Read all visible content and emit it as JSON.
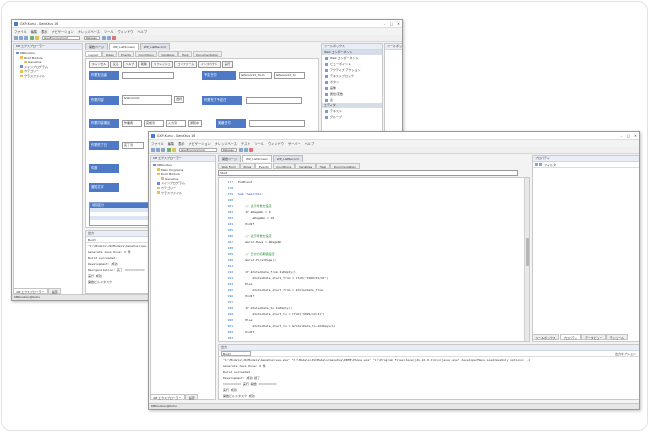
{
  "back_window": {
    "title": "GXP-Kuhu - GeneXus 16",
    "menu": [
      "ファイル",
      "編集",
      "表示",
      "ナビゲーション",
      "ナレッジベース",
      "ツール",
      "ウィンドウ",
      "ヘルプ"
    ],
    "env_combo": "JavaEnvironment",
    "config_combo": "Release",
    "kb_explorer_title": "KB エクスプローラー",
    "tree": [
      "KBKoubou",
      "Root Module",
      "GeneXus",
      "メインプログラム",
      "カテゴリー",
      "クラスファイル"
    ],
    "tabs": [
      "開始ページ",
      "WP_ListScreen",
      "WP_ListRecord"
    ],
    "subtabs": [
      "Layout",
      "Rules",
      "Events",
      "Conditions",
      "Variables",
      "Help",
      "Documentation"
    ],
    "form_buttons": [
      "キャンセル",
      "戻る",
      "ヘルプ",
      "削除",
      "リフレッシュ",
      "コンファーム",
      "インスペクト",
      "実行"
    ],
    "form_labels": [
      "作業担当者",
      "作業内容",
      "予定日付",
      "作業内容補足",
      "作業完了予定日",
      "実績日付",
      "作業終了日",
      "件数",
      "通知文字"
    ],
    "form_values": [
      "&PersonId_from",
      "&PersonId_to",
      "&WorkInfo",
      "選択",
      "作業者",
      "完成済",
      "入力済",
      "通知中",
      "完了済"
    ],
    "grid_header": "項目区分",
    "output_title": "出力",
    "output_filter": "Build",
    "output_lines": [
      "\"C:\\Models\\JSCModels\\GeneXus\\vea.exe\" ...",
      "Generate Java Done: 0 件",
      "Build succeeded.",
      "Development: 成功",
      "Reorganization: 完了 ===========",
      "実行 成功",
      "開始ビルドタスク"
    ],
    "toolbox_title": "ツールボックス",
    "toolbox_sections": [
      "Web コンポーネント",
      "エディタ"
    ],
    "toolbox_items": [
      "Web コンポーネント",
      "ビューポイント",
      "アクティブ アクション",
      "テキストブロック",
      "ボタン",
      "画像",
      "属性/変数",
      "表"
    ],
    "toolbox_items2": [
      "テキスト",
      "グループ"
    ],
    "bottom_tabs": [
      "KB エクスプローラー",
      "設定"
    ],
    "status": "KBKoubou@Kuhu"
  },
  "front_window": {
    "title": "GXP-Kuhu - GeneXus 16",
    "menu": [
      "ファイル",
      "編集",
      "表示",
      "ナビゲーション",
      "ナレッジベース",
      "テスト",
      "ツール",
      "ウィンドウ",
      "サーバー",
      "ヘルプ"
    ],
    "env_combo": "JavaEnvironment",
    "config_combo": "Release",
    "kb_explorer_title": "KB エクスプローラー",
    "tree": [
      "KBKoubou",
      "Main Programs",
      "Root Module",
      "GeneXus",
      "メインプログラム",
      "カテゴリー",
      "クラスファイル"
    ],
    "tabs": [
      "開始ページ",
      "WP_ListScreen",
      "WP_ListRecord"
    ],
    "subtabs": [
      "Web Form",
      "Rules",
      "Events",
      "Conditions",
      "Variables",
      "Help",
      "Documentation"
    ],
    "event_combo": "Start",
    "code_lines": [
      {
        "n": "177",
        "t": "EndEvent",
        "c": ""
      },
      {
        "n": "178",
        "t": "",
        "c": ""
      },
      {
        "n": "179",
        "t": "Sub 'SearchCo'",
        "c": "kw"
      },
      {
        "n": "180",
        "t": "",
        "c": ""
      },
      {
        "n": "181",
        "t": "    // 表示件数を設定",
        "c": "cm"
      },
      {
        "n": "182",
        "t": "    If &PageNo = 0",
        "c": ""
      },
      {
        "n": "183",
        "t": "        &PageNo = 10",
        "c": ""
      },
      {
        "n": "184",
        "t": "    EndIf",
        "c": ""
      },
      {
        "n": "185",
        "t": "",
        "c": ""
      },
      {
        "n": "186",
        "t": "    // 表示件数を設定",
        "c": "cm"
      },
      {
        "n": "187",
        "t": "    &Grid.Rows = &PageNo",
        "c": ""
      },
      {
        "n": "188",
        "t": "",
        "c": ""
      },
      {
        "n": "189",
        "t": "    // 日付の初期値設定",
        "c": "cm"
      },
      {
        "n": "190",
        "t": "    &Grid.FirstPage()",
        "c": ""
      },
      {
        "n": "191",
        "t": "",
        "c": ""
      },
      {
        "n": "192",
        "t": "    If &YoteiDate_from.IsEmpty()",
        "c": ""
      },
      {
        "n": "193",
        "t": "        &YoteiDate_start_from = CToD(\"1900/01/01\")",
        "c": ""
      },
      {
        "n": "194",
        "t": "    Else",
        "c": ""
      },
      {
        "n": "195",
        "t": "        &YoteiDate_start_from = &YoteiDate_from",
        "c": ""
      },
      {
        "n": "196",
        "t": "    EndIf",
        "c": ""
      },
      {
        "n": "197",
        "t": "",
        "c": ""
      },
      {
        "n": "198",
        "t": "    If &YoteiDate_to.IsEmpty()",
        "c": ""
      },
      {
        "n": "199",
        "t": "        &YoteiDate_start_to = CToD(\"9999/12/31\")",
        "c": ""
      },
      {
        "n": "200",
        "t": "    Else",
        "c": ""
      },
      {
        "n": "201",
        "t": "        &YoteiDate_start_to = &YoteiDate_to.AddDays(1)",
        "c": ""
      },
      {
        "n": "202",
        "t": "    EndIf",
        "c": ""
      },
      {
        "n": "203",
        "t": "",
        "c": ""
      },
      {
        "n": "204",
        "t": "    // 検索開始日付 Keyword And Start",
        "c": "cm"
      },
      {
        "n": "205",
        "t": "    If &Hasseis_from.IsEmpty()",
        "c": ""
      },
      {
        "n": "206",
        "t": "        &Hasseis_start_from = CToD(\"1900/01/01\")",
        "c": ""
      },
      {
        "n": "207",
        "t": "    Else",
        "c": ""
      },
      {
        "n": "208",
        "t": "        &Hasseis_start_from = &Hasseis_from",
        "c": ""
      },
      {
        "n": "209",
        "t": "    EndIf",
        "c": ""
      },
      {
        "n": "210",
        "t": "",
        "c": ""
      },
      {
        "n": "211",
        "t": "    If &Hasseis_to.IsEmpty()",
        "c": ""
      }
    ],
    "properties_title": "プロパティ",
    "prop_toolbar": "フィルタ",
    "right_bottom_tabs": [
      "ツールボックス",
      "プロパティ",
      "データビュー",
      "モジュール",
      "エディタ",
      "ドキュメント"
    ],
    "output_title": "出力",
    "output_filter": "Build",
    "output_lines": [
      "\"C:\\Models\\JSCModels\\GeneXus\\vea.exe\" \"C:\\Models\\JSCModels\\GeneXus\\KBTB\\Phone.exe\" \"C:\\Program Files\\Java\\jdk-16.0.1\\bin\\javac.exe\" developerMenu.LoadJavaOnly options: -1",
      "Generate Java Done: 0 件",
      "Build succeeded.",
      "Development: 成功 終了",
      "========== 実行 開始 ==========",
      "実行 成功",
      "開始ビルドタスク 成功"
    ],
    "output_right": "出力オプション",
    "bottom_tabs": [
      "KB エクスプローラー",
      "設定"
    ],
    "status": "KBKoubou@Kuhu"
  }
}
